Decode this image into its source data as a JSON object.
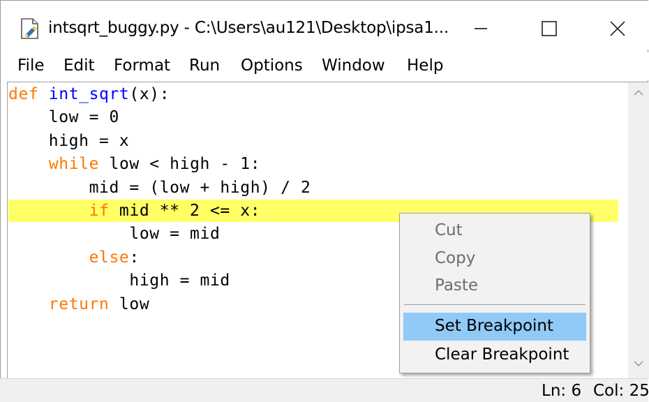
{
  "window": {
    "title": "intsqrt_buggy.py - C:\\Users\\au121\\Desktop\\ipsa1...",
    "minimize_icon": "minimize-icon",
    "maximize_icon": "maximize-icon",
    "close_icon": "close-icon"
  },
  "menubar": {
    "items": [
      {
        "label": "File"
      },
      {
        "label": "Edit"
      },
      {
        "label": "Format"
      },
      {
        "label": "Run"
      },
      {
        "label": "Options"
      },
      {
        "label": "Window"
      },
      {
        "label": "Help"
      }
    ]
  },
  "editor": {
    "lines": [
      [
        {
          "t": "def",
          "c": "kw"
        },
        {
          "t": " ",
          "c": ""
        },
        {
          "t": "int_sqrt",
          "c": "fn"
        },
        {
          "t": "(x):",
          "c": ""
        }
      ],
      [
        {
          "t": "    low = 0",
          "c": ""
        }
      ],
      [
        {
          "t": "    high = x",
          "c": ""
        }
      ],
      [
        {
          "t": "    ",
          "c": ""
        },
        {
          "t": "while",
          "c": "kw"
        },
        {
          "t": " low < high - 1:",
          "c": ""
        }
      ],
      [
        {
          "t": "        mid = (low + high) / 2",
          "c": ""
        }
      ],
      [
        {
          "t": "        ",
          "c": ""
        },
        {
          "t": "if",
          "c": "kw"
        },
        {
          "t": " mid ** 2 <= x:",
          "c": ""
        }
      ],
      [
        {
          "t": "            low = mid",
          "c": ""
        }
      ],
      [
        {
          "t": "        ",
          "c": ""
        },
        {
          "t": "else",
          "c": "kw"
        },
        {
          "t": ":",
          "c": ""
        }
      ],
      [
        {
          "t": "            high = mid",
          "c": ""
        }
      ],
      [
        {
          "t": "    ",
          "c": ""
        },
        {
          "t": "return",
          "c": "kw"
        },
        {
          "t": " low",
          "c": ""
        }
      ]
    ],
    "breakpoint_line": 6,
    "colors": {
      "keyword": "#ff7700",
      "function": "#0000ff",
      "breakpoint": "#ffff66"
    }
  },
  "context_menu": {
    "cut": "Cut",
    "copy": "Copy",
    "paste": "Paste",
    "set_breakpoint": "Set Breakpoint",
    "clear_breakpoint": "Clear Breakpoint"
  },
  "statusbar": {
    "line": "Ln: 6",
    "col": "Col: 25"
  }
}
